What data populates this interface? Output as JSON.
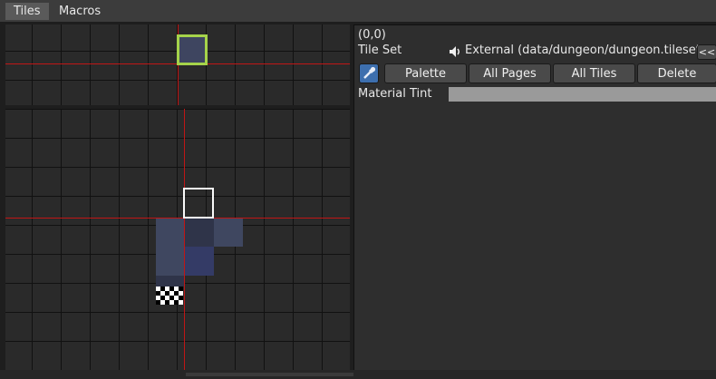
{
  "tabs": [
    {
      "label": "Tiles",
      "active": true
    },
    {
      "label": "Macros",
      "active": false
    }
  ],
  "inspector": {
    "coords": "(0,0)",
    "tileset_label": "Tile Set",
    "tileset_icon": "speaker-icon",
    "tileset_value": "External (data/dungeon/dungeon.tileset)",
    "collapse_button": "<<",
    "picker_icon": "eyedropper-icon",
    "buttons": [
      "Palette",
      "All Pages",
      "All Tiles",
      "Delete"
    ],
    "material_tint_label": "Material Tint",
    "material_tint_color": "#9a9a9a"
  },
  "colors": {
    "grid_line": "#111111",
    "axis": "#c01616",
    "selection": "#a5d34a",
    "picker_active": "#3d6fae"
  }
}
